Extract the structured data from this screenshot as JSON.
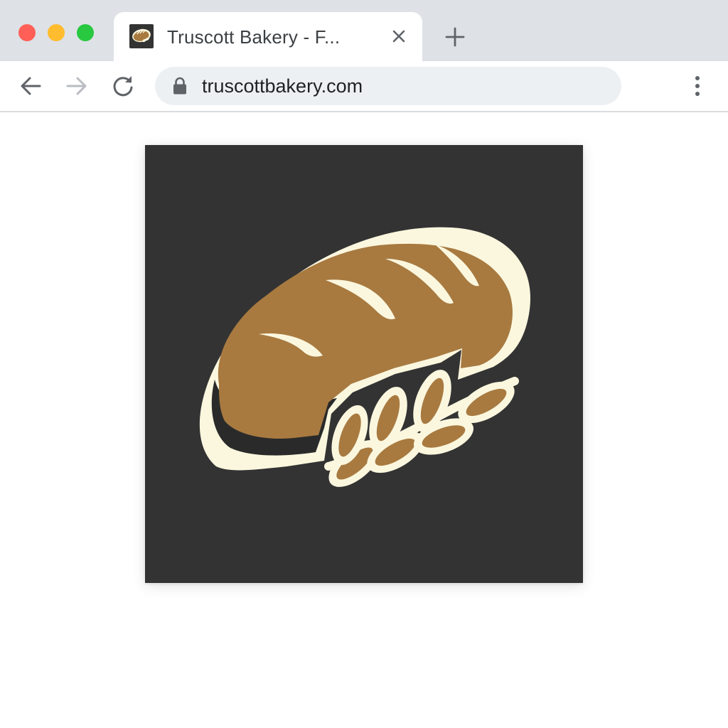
{
  "window": {
    "controls": [
      "close",
      "minimize",
      "zoom"
    ]
  },
  "tab": {
    "title": "Truscott Bakery - F...",
    "favicon": "bread-loaf-icon"
  },
  "toolbar": {
    "url": "truscottbakery.com",
    "icons": [
      "back-arrow-icon",
      "forward-arrow-icon",
      "reload-icon",
      "lock-icon",
      "kebab-menu-icon",
      "close-icon",
      "plus-icon"
    ]
  },
  "page": {
    "logo": "bread-loaf-with-wheat-logo"
  },
  "colors": {
    "tabstrip": "#dee1e6",
    "omnibox": "#edf0f3",
    "logo_background": "#333333",
    "bread": "#a87a40",
    "cream": "#fbf7df"
  }
}
